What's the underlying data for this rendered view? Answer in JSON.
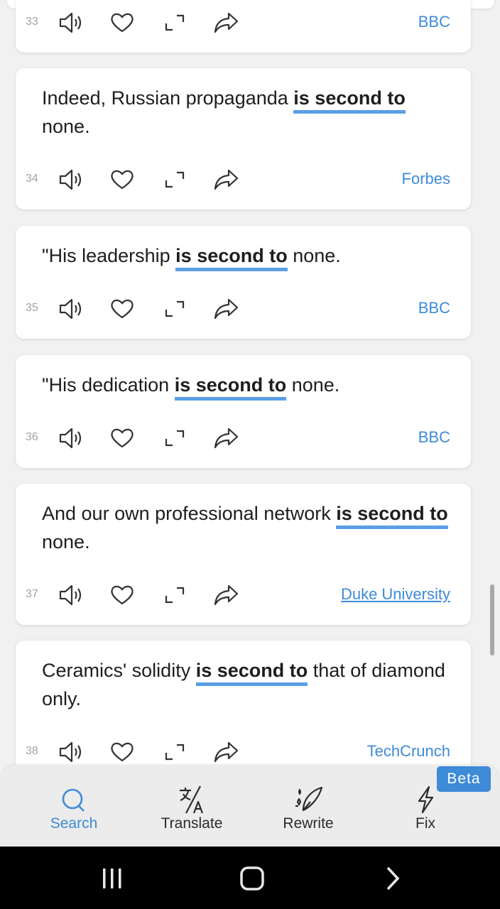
{
  "results": [
    {
      "number": "33",
      "source": "BBC",
      "source_link": false,
      "parts": {
        "before": "",
        "highlight": "",
        "after": ""
      }
    },
    {
      "number": "34",
      "source": "Forbes",
      "source_link": false,
      "parts": {
        "before": "Indeed, Russian propaganda ",
        "highlight": "is second to",
        "after": " none."
      }
    },
    {
      "number": "35",
      "source": "BBC",
      "source_link": false,
      "parts": {
        "before": "\"His leadership ",
        "highlight": "is second to",
        "after": " none."
      }
    },
    {
      "number": "36",
      "source": "BBC",
      "source_link": false,
      "parts": {
        "before": "\"His dedication ",
        "highlight": "is second to",
        "after": " none."
      }
    },
    {
      "number": "37",
      "source": "Duke University",
      "source_link": true,
      "parts": {
        "before": "And our own professional network ",
        "highlight": "is second to",
        "after": " none."
      }
    },
    {
      "number": "38",
      "source": "TechCrunch",
      "source_link": false,
      "parts": {
        "before": "Ceramics' solidity ",
        "highlight": "is second to",
        "after": " that of diamond only."
      }
    }
  ],
  "action_icons": [
    "speaker-icon",
    "heart-icon",
    "expand-icon",
    "share-icon"
  ],
  "bottom_nav": {
    "tabs": [
      {
        "label": "Search",
        "icon": "search-icon",
        "active": true
      },
      {
        "label": "Translate",
        "icon": "translate-icon",
        "active": false
      },
      {
        "label": "Rewrite",
        "icon": "quill-icon",
        "active": false
      },
      {
        "label": "Fix",
        "icon": "lightning-icon",
        "active": false
      }
    ],
    "badge": "Beta"
  },
  "colors": {
    "accent": "#3e8bd8",
    "highlight_underline": "#5b9ee6",
    "background": "#f1f1f1"
  }
}
